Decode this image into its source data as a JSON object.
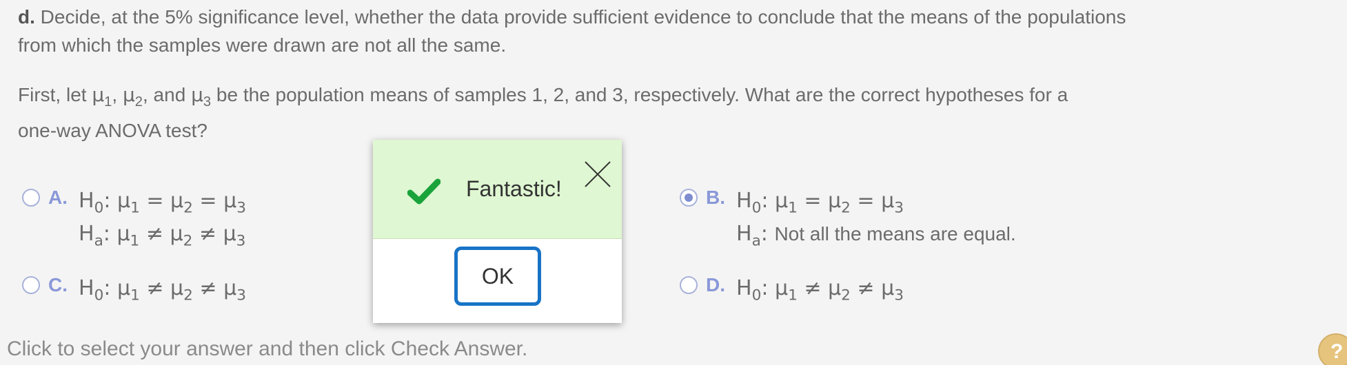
{
  "question": {
    "part_label": "d.",
    "part_text_line1": " Decide, at the 5% significance level, whether the data provide sufficient evidence to conclude that the means of the populations",
    "part_text_line2": "from which the samples were drawn are not all the same.",
    "intro_a": "First, let ",
    "intro_sep1": ", ",
    "intro_sep2": ", and ",
    "intro_b": " be the population means of samples 1, 2, and 3, respectively. What are the correct hypotheses for a",
    "intro_line2": "one-way ANOVA test?"
  },
  "symbols": {
    "mu": "μ",
    "h": "H",
    "sub0": "0",
    "suba": "a",
    "sub1": "1",
    "sub2": "2",
    "sub3": "3",
    "colon": ": ",
    "eq": " = ",
    "neq": " ≠ "
  },
  "options": [
    {
      "letter": "A.",
      "selected": false
    },
    {
      "letter": "B.",
      "selected": true,
      "ha_text": "Not all the means are equal."
    },
    {
      "letter": "C.",
      "selected": false
    },
    {
      "letter": "D.",
      "selected": false
    }
  ],
  "feedback_dialog": {
    "message": "Fantastic!",
    "ok_label": "OK",
    "icons": {
      "status": "checkmark-icon",
      "close": "close-icon"
    },
    "colors": {
      "header_bg": "#dff7d2",
      "check": "#1aa33a",
      "ok_border": "#1873c6"
    }
  },
  "footer": {
    "instruction": "Click to select your answer and then click Check Answer.",
    "help_label": "?"
  }
}
